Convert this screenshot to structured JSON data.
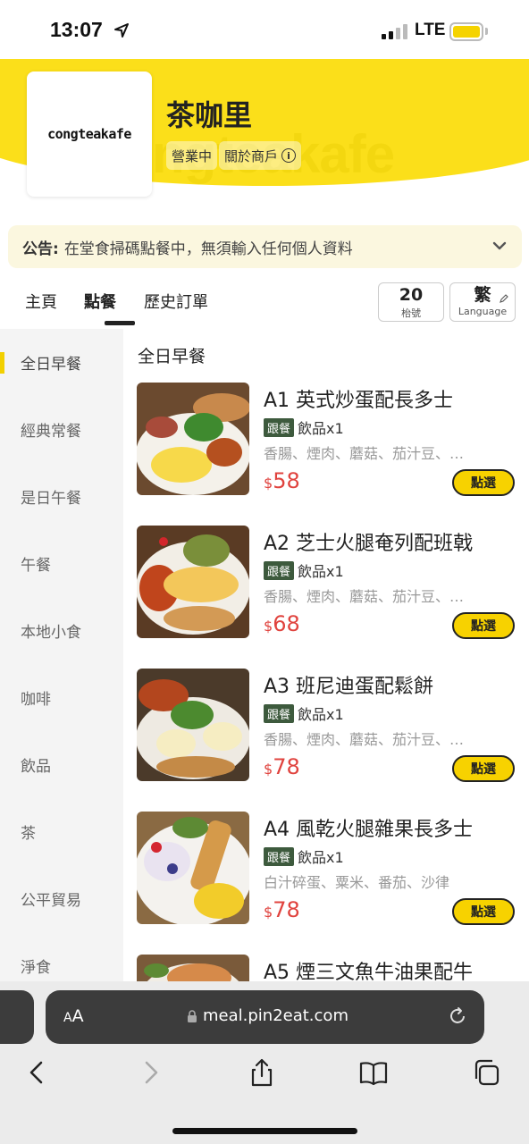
{
  "status_bar": {
    "time": "13:07",
    "network": "LTE"
  },
  "shop": {
    "logo_text": "congteakafe",
    "name": "茶咖里",
    "status_tag": "營業中",
    "about_tag": "關於商戶"
  },
  "notice": {
    "label": "公告:",
    "text": "在堂食掃碼點餐中，無須輸入任何個人資料"
  },
  "tabs": {
    "home": "主頁",
    "order": "點餐",
    "history": "歷史訂單",
    "number_value": "20",
    "number_label": "枱號",
    "lang_value": "繁",
    "lang_label": "Language"
  },
  "categories": [
    "全日早餐",
    "經典常餐",
    "是日午餐",
    "午餐",
    "本地小食",
    "咖啡",
    "飲品",
    "茶",
    "公平貿易",
    "淨食"
  ],
  "section_title": "全日早餐",
  "items": [
    {
      "name": "A1 英式炒蛋配長多士",
      "badge": "跟餐",
      "drink": "飲品x1",
      "desc": "香腸、煙肉、蘑菇、茄汁豆、…",
      "currency": "$",
      "price": "58",
      "button": "點選"
    },
    {
      "name": "A2 芝士火腿奄列配班戟",
      "badge": "跟餐",
      "drink": "飲品x1",
      "desc": "香腸、煙肉、蘑菇、茄汁豆、…",
      "currency": "$",
      "price": "68",
      "button": "點選"
    },
    {
      "name": "A3 班尼迪蛋配鬆餅",
      "badge": "跟餐",
      "drink": "飲品x1",
      "desc": "香腸、煙肉、蘑菇、茄汁豆、…",
      "currency": "$",
      "price": "78",
      "button": "點選"
    },
    {
      "name": "A4 風乾火腿雜果長多士",
      "badge": "跟餐",
      "drink": "飲品x1",
      "desc": "白汁碎蛋、粟米、番茄、沙律",
      "currency": "$",
      "price": "78",
      "button": "點選"
    },
    {
      "name": "A5 煙三文魚牛油果配牛"
    }
  ],
  "browser": {
    "aa_small": "A",
    "aa_big": "A",
    "url": "meal.pin2eat.com"
  },
  "colors": {
    "brand_yellow": "#fbdf1a",
    "price_red": "#e0433e",
    "badge_green": "#3d5a3d"
  }
}
